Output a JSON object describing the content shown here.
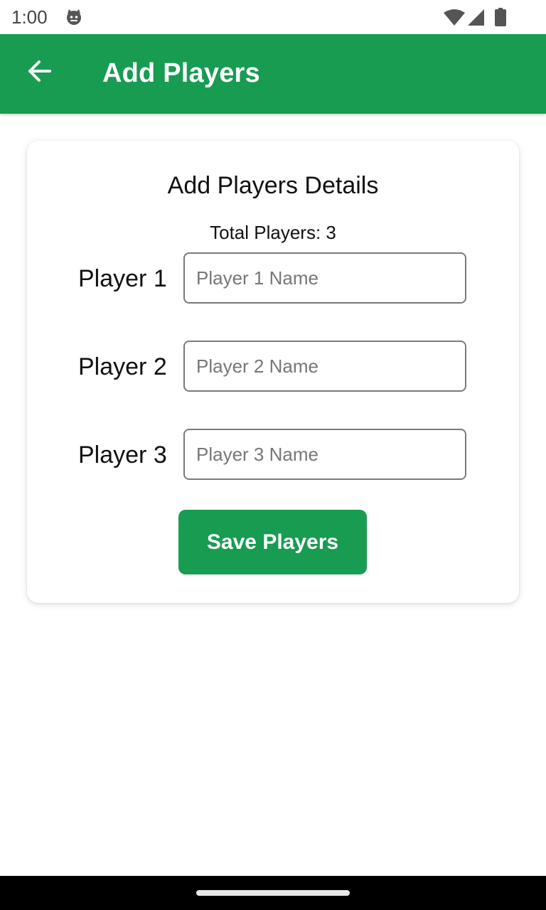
{
  "status_bar": {
    "time": "1:00",
    "app_icon": "cat-face-icon",
    "wifi_icon": "wifi-icon",
    "signal_icon": "cell-signal-icon",
    "battery_icon": "battery-icon"
  },
  "app_bar": {
    "title": "Add Players",
    "back_icon": "arrow-back-icon",
    "color": "#179c52"
  },
  "card": {
    "title": "Add Players Details",
    "total_players": "Total Players: 3",
    "players": [
      {
        "label": "Player 1",
        "placeholder": "Player 1 Name",
        "value": ""
      },
      {
        "label": "Player 2",
        "placeholder": "Player 2 Name",
        "value": ""
      },
      {
        "label": "Player 3",
        "placeholder": "Player 3 Name",
        "value": ""
      }
    ],
    "save_label": "Save Players"
  }
}
